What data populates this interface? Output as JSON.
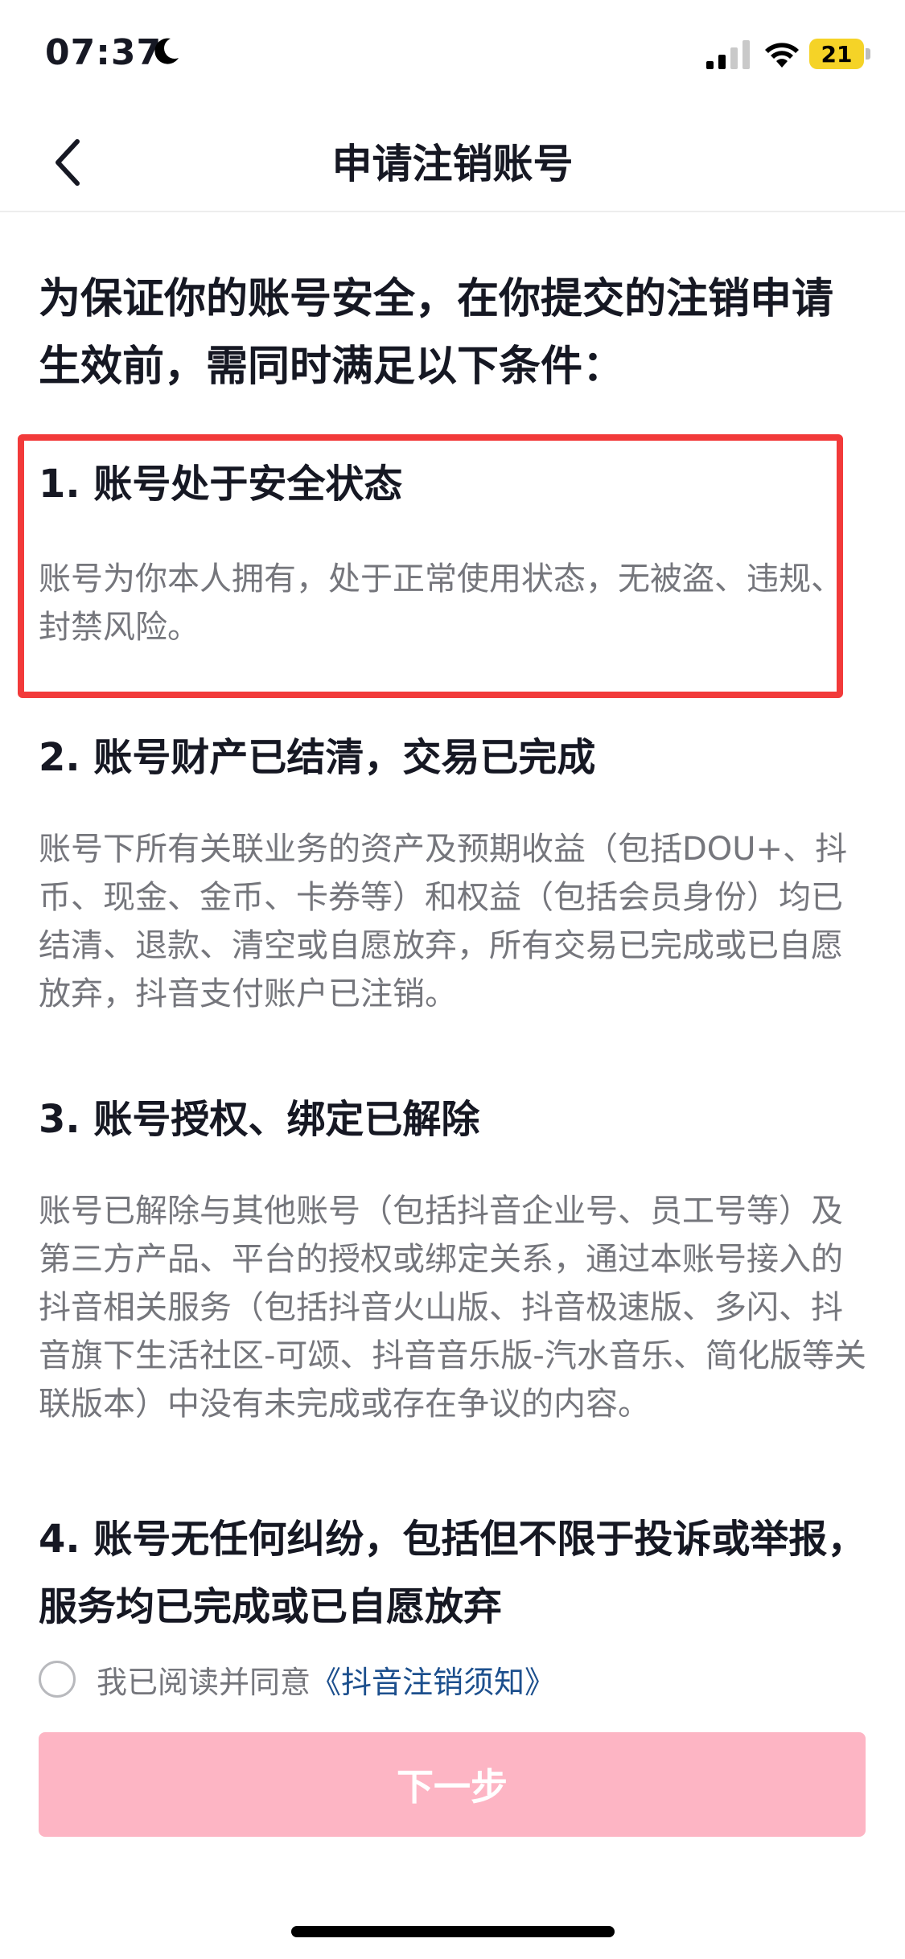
{
  "status_bar": {
    "time": "07:37",
    "battery": "21",
    "icons": [
      "moon-icon",
      "signal-icon",
      "wifi-icon",
      "battery-icon"
    ]
  },
  "nav": {
    "title": "申请注销账号",
    "back_icon": "chevron-left-icon"
  },
  "intro": "为保证你的账号安全，在你提交的注销申请生效前，需同时满足以下条件：",
  "conditions": [
    {
      "title": "1. 账号处于安全状态",
      "body": "账号为你本人拥有，处于正常使用状态，无被盗、违规、封禁风险。"
    },
    {
      "title": "2. 账号财产已结清，交易已完成",
      "body": "账号下所有关联业务的资产及预期收益（包括DOU+、抖币、现金、金币、卡券等）和权益（包括会员身份）均已结清、退款、清空或自愿放弃，所有交易已完成或已自愿放弃，抖音支付账户已注销。"
    },
    {
      "title": "3. 账号授权、绑定已解除",
      "body": "账号已解除与其他账号（包括抖音企业号、员工号等）及第三方产品、平台的授权或绑定关系，通过本账号接入的抖音相关服务（包括抖音火山版、抖音极速版、多闪、抖音旗下生活社区-可颂、抖音音乐版-汽水音乐、简化版等关联版本）中没有未完成或存在争议的内容。"
    },
    {
      "title": "4. 账号无任何纠纷，包括但不限于投诉或举报，服务均已完成或已自愿放弃",
      "body": ""
    }
  ],
  "agreement": {
    "text": "我已阅读并同意",
    "link": "《抖音注销须知》",
    "checked": false
  },
  "next_button": "下一步",
  "colors": {
    "highlight_border": "#f23a3a",
    "button_disabled": "#fdb5c4",
    "link": "#1c4f8d"
  }
}
